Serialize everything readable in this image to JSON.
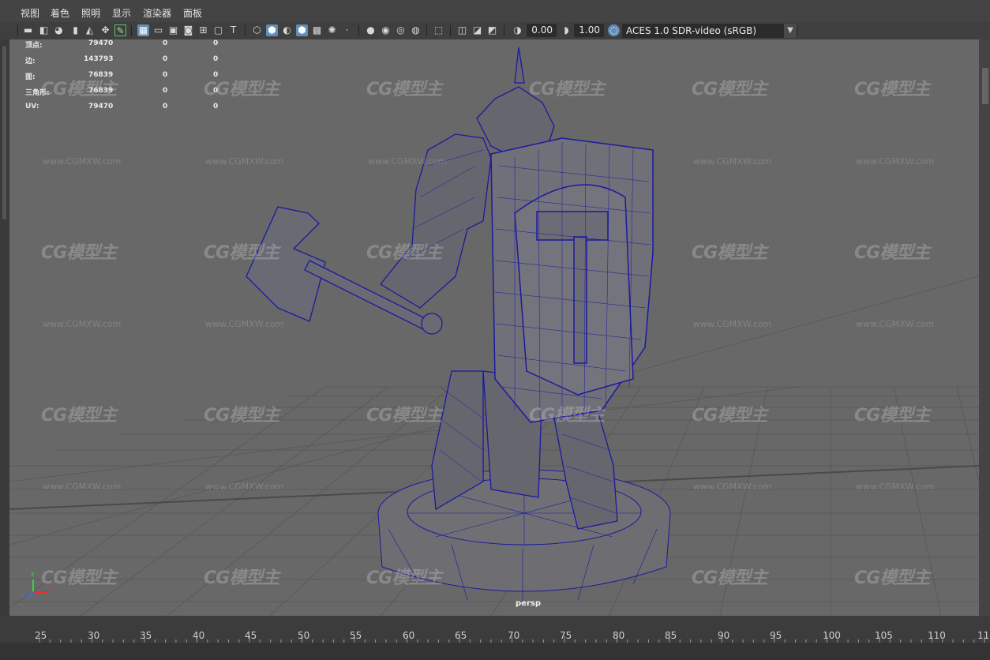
{
  "menu": [
    "视图",
    "着色",
    "照明",
    "显示",
    "渲染器",
    "面板"
  ],
  "toolbar": {
    "exposure": "0.00",
    "gamma": "1.00",
    "colorspace": "ACES 1.0 SDR-video (sRGB)",
    "icons": [
      "camera-icon",
      "camera-attr-icon",
      "bookmark-icon",
      "image-plane-icon",
      "grid-select-icon",
      "2d-pan-icon",
      "grease-pencil-icon",
      "grid-icon",
      "film-gate-icon",
      "resolution-gate-icon",
      "gate-mask-icon",
      "field-chart-icon",
      "safe-action-icon",
      "safe-title-icon",
      "wireframe-icon",
      "smooth-shade-icon",
      "wireframe-on-shaded-icon",
      "textured-icon",
      "use-lights-icon",
      "shadows-icon",
      "ambient-occlusion-icon",
      "motion-blur-icon",
      "anti-alias-icon",
      "depth-of-field-icon",
      "isolate-select-icon",
      "xray-icon",
      "xray-joints-icon",
      "backface-icon",
      "exposure-icon",
      "gamma-icon",
      "color-management-icon"
    ]
  },
  "hud": {
    "rows": [
      {
        "label": "顶点:",
        "v1": "79470",
        "v2": "0",
        "v3": "0"
      },
      {
        "label": "边:",
        "v1": "143793",
        "v2": "0",
        "v3": "0"
      },
      {
        "label": "面:",
        "v1": "76839",
        "v2": "0",
        "v3": "0"
      },
      {
        "label": "三角形:",
        "v1": "76839",
        "v2": "0",
        "v3": "0"
      },
      {
        "label": "UV:",
        "v1": "79470",
        "v2": "0",
        "v3": "0"
      }
    ]
  },
  "viewport": {
    "camera_label": "persp",
    "watermark": "CG模型主",
    "watermark_url": "www.CGMXW.com",
    "wire_color": "#1a1aa0",
    "grid_color": "#5a5a5a",
    "bg_color": "#686868"
  },
  "axis": {
    "x": "x",
    "y": "y",
    "z": "z"
  },
  "timeline": {
    "ticks": [
      "25",
      "30",
      "35",
      "40",
      "45",
      "50",
      "55",
      "60",
      "65",
      "70",
      "75",
      "80",
      "85",
      "90",
      "95",
      "100",
      "105",
      "110",
      "11"
    ]
  }
}
